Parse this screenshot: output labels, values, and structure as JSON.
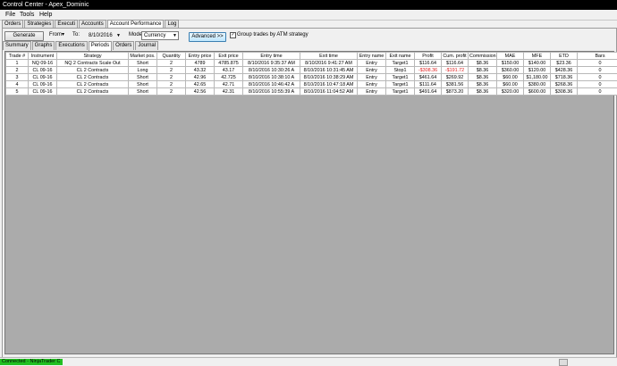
{
  "window": {
    "title": "Control Center - Apex_Dominic"
  },
  "menu": [
    "File",
    "Tools",
    "Help"
  ],
  "main_tabs": [
    {
      "label": "Orders",
      "active": false
    },
    {
      "label": "Strategies",
      "active": false
    },
    {
      "label": "Executi",
      "active": false
    },
    {
      "label": "Accounts",
      "active": false
    },
    {
      "label": "Account Performance",
      "active": true
    },
    {
      "label": "Log",
      "active": false
    }
  ],
  "toolbar": {
    "generate_label": "Generate",
    "from_label": "From",
    "to_label": "To:",
    "to_value": "8/10/2016",
    "mode_label": "Mode:",
    "mode_value": "Currency",
    "advanced_label": "Advanced >>",
    "group_label": "Group trades by ATM strategy",
    "group_checked": true
  },
  "sub_tabs": [
    {
      "label": "Summary",
      "active": false
    },
    {
      "label": "Graphs",
      "active": false
    },
    {
      "label": "Executions",
      "active": false
    },
    {
      "label": "Periods",
      "active": false
    },
    {
      "label": "Orders",
      "active": false
    },
    {
      "label": "Journal",
      "active": false
    }
  ],
  "table": {
    "columns": [
      "Trade #",
      "Instrument",
      "Strategy",
      "Market pos.",
      "Quantity",
      "Entry price",
      "Exit price",
      "Entry time",
      "Exit time",
      "Entry name",
      "Exit name",
      "Profit",
      "Cum. profit",
      "Commission",
      "MAE",
      "MFE",
      "ETD",
      "Bars"
    ],
    "rows": [
      [
        "1",
        "NQ 09-16",
        "NQ 2 Contracts Scale Out",
        "Short",
        "2",
        "4789",
        "4785.875",
        "8/10/2016 9:35:37 AM",
        "8/10/2016 9:41:27 AM",
        "Entry",
        "Target1",
        "$116.64",
        "$116.64",
        "$8.36",
        "$150.00",
        "$140.00",
        "$23.36",
        "0"
      ],
      [
        "2",
        "CL 09-16",
        "CL 2 Contracts",
        "Long",
        "2",
        "43.32",
        "43.17",
        "8/10/2016 10:30:26 A",
        "8/10/2016 10:31:45 AM",
        "Entry",
        "Stop1",
        "-$308.36",
        "-$191.72",
        "$8.36",
        "$360.00",
        "$120.00",
        "$428.36",
        "0"
      ],
      [
        "3",
        "CL 09-16",
        "CL 2 Contracts",
        "Short",
        "2",
        "42.96",
        "42.725",
        "8/10/2016 10:38:10 A",
        "8/10/2016 10:38:29 AM",
        "Entry",
        "Target1",
        "$461.64",
        "$269.92",
        "$8.36",
        "$60.00",
        "$1,180.00",
        "$718.36",
        "0"
      ],
      [
        "4",
        "CL 09-16",
        "CL 2 Contracts",
        "Short",
        "2",
        "42.65",
        "42.71",
        "8/10/2016 10:46:42 A",
        "8/10/2016 10:47:18 AM",
        "Entry",
        "Target1",
        "$111.64",
        "$381.56",
        "$8.36",
        "$60.00",
        "$380.00",
        "$268.36",
        "0"
      ],
      [
        "5",
        "CL 09-16",
        "CL 2 Contracts",
        "Short",
        "2",
        "42.56",
        "42.31",
        "8/10/2016 10:55:39 A",
        "8/10/2016 11:04:52 AM",
        "Entry",
        "Target1",
        "$491.64",
        "$873.20",
        "$8.36",
        "$320.00",
        "$600.00",
        "$308.36",
        "0"
      ]
    ]
  },
  "status": {
    "text": "Connected - NinjaTrader C"
  },
  "colors": {
    "negative": "#e02020",
    "connected": "#22c022",
    "grid_bg": "#ababab"
  }
}
